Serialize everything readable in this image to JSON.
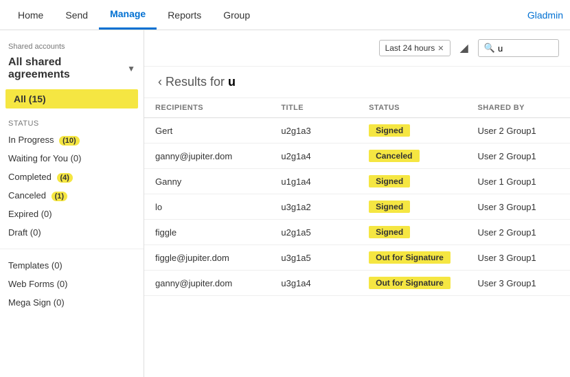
{
  "nav": {
    "items": [
      {
        "label": "Home",
        "active": false
      },
      {
        "label": "Send",
        "active": false
      },
      {
        "label": "Manage",
        "active": true
      },
      {
        "label": "Reports",
        "active": false
      },
      {
        "label": "Group",
        "active": false
      }
    ],
    "user": "Gladmin"
  },
  "sidebar": {
    "shared_accounts_label": "Shared accounts",
    "all_agreements_label": "All shared agreements",
    "all_item": "All (15)",
    "status_section": "STATUS",
    "items": [
      {
        "label": "In Progress",
        "badge": "(10)"
      },
      {
        "label": "Waiting for You",
        "badge": "(0)"
      },
      {
        "label": "Completed",
        "badge": "(4)"
      },
      {
        "label": "Canceled",
        "badge": "(1)"
      },
      {
        "label": "Expired",
        "badge": "(0)"
      },
      {
        "label": "Draft",
        "badge": "(0)"
      }
    ],
    "bottom_items": [
      {
        "label": "Templates",
        "badge": "(0)"
      },
      {
        "label": "Web Forms",
        "badge": "(0)"
      },
      {
        "label": "Mega Sign",
        "badge": "(0)"
      }
    ]
  },
  "content": {
    "time_filter": "Last 24 hours",
    "search_value": "u",
    "results_label": "Results for",
    "results_query": "u",
    "table": {
      "columns": [
        "Recipients",
        "Title",
        "Status",
        "Shared By"
      ],
      "rows": [
        {
          "recipient": "Gert",
          "title": "u2g1a3",
          "status": "Signed",
          "status_type": "signed",
          "shared_by": "User 2 Group1"
        },
        {
          "recipient": "ganny@jupiter.dom",
          "title": "u2g1a4",
          "status": "Canceled",
          "status_type": "canceled",
          "shared_by": "User 2 Group1"
        },
        {
          "recipient": "Ganny",
          "title": "u1g1a4",
          "status": "Signed",
          "status_type": "signed",
          "shared_by": "User 1 Group1"
        },
        {
          "recipient": "lo",
          "title": "u3g1a2",
          "status": "Signed",
          "status_type": "signed",
          "shared_by": "User 3 Group1"
        },
        {
          "recipient": "figgle",
          "title": "u2g1a5",
          "status": "Signed",
          "status_type": "signed",
          "shared_by": "User 2 Group1"
        },
        {
          "recipient": "figgle@jupiter.dom",
          "title": "u3g1a5",
          "status": "Out for Signature",
          "status_type": "out-for-sig",
          "shared_by": "User 3 Group1"
        },
        {
          "recipient": "ganny@jupiter.dom",
          "title": "u3g1a4",
          "status": "Out for Signature",
          "status_type": "out-for-sig",
          "shared_by": "User 3 Group1"
        }
      ]
    }
  }
}
